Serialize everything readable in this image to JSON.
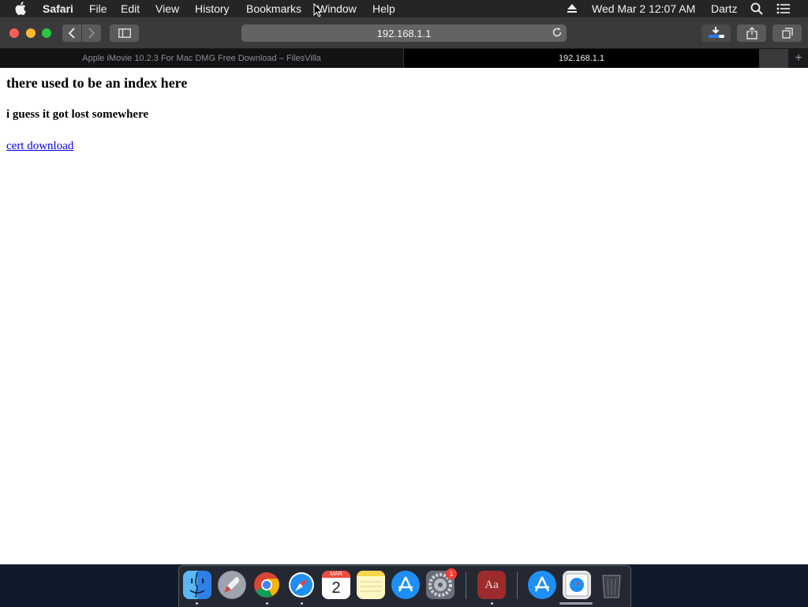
{
  "menubar": {
    "app_name": "Safari",
    "items": [
      "File",
      "Edit",
      "View",
      "History",
      "Bookmarks",
      "Window",
      "Help"
    ],
    "date_time": "Wed Mar 2  12:07 AM",
    "user": "Dartz",
    "icons": [
      "apple-icon",
      "eject-icon",
      "spotlight-search-icon",
      "notification-center-icon"
    ]
  },
  "toolbar": {
    "address": "192.168.1.1",
    "icons": [
      "back-icon",
      "forward-icon",
      "sidebar-icon",
      "reload-icon",
      "downloads-icon",
      "share-icon",
      "tab-overview-icon"
    ]
  },
  "tabs": [
    {
      "title": "Apple iMovie 10.2.3 For Mac DMG Free Download – FilesVilla",
      "active": false
    },
    {
      "title": "192.168.1.1",
      "active": true
    }
  ],
  "page": {
    "heading": "there used to be an index here",
    "subheading": "i guess it got lost somewhere",
    "link": "cert download"
  },
  "dock": {
    "calendar_month": "MAR",
    "calendar_day": "2",
    "badge_count": "1",
    "dictionary_label": "Aa",
    "apps": [
      "Finder",
      "Launchpad",
      "Chrome",
      "Safari",
      "Calendar",
      "Notes",
      "App Store",
      "System Preferences",
      "Dictionary",
      "Applications",
      "Downloads",
      "Trash"
    ]
  },
  "colors": {
    "close": "#ff5f57",
    "minimize": "#febc2e",
    "zoom": "#28c840",
    "link": "#0000ee"
  }
}
